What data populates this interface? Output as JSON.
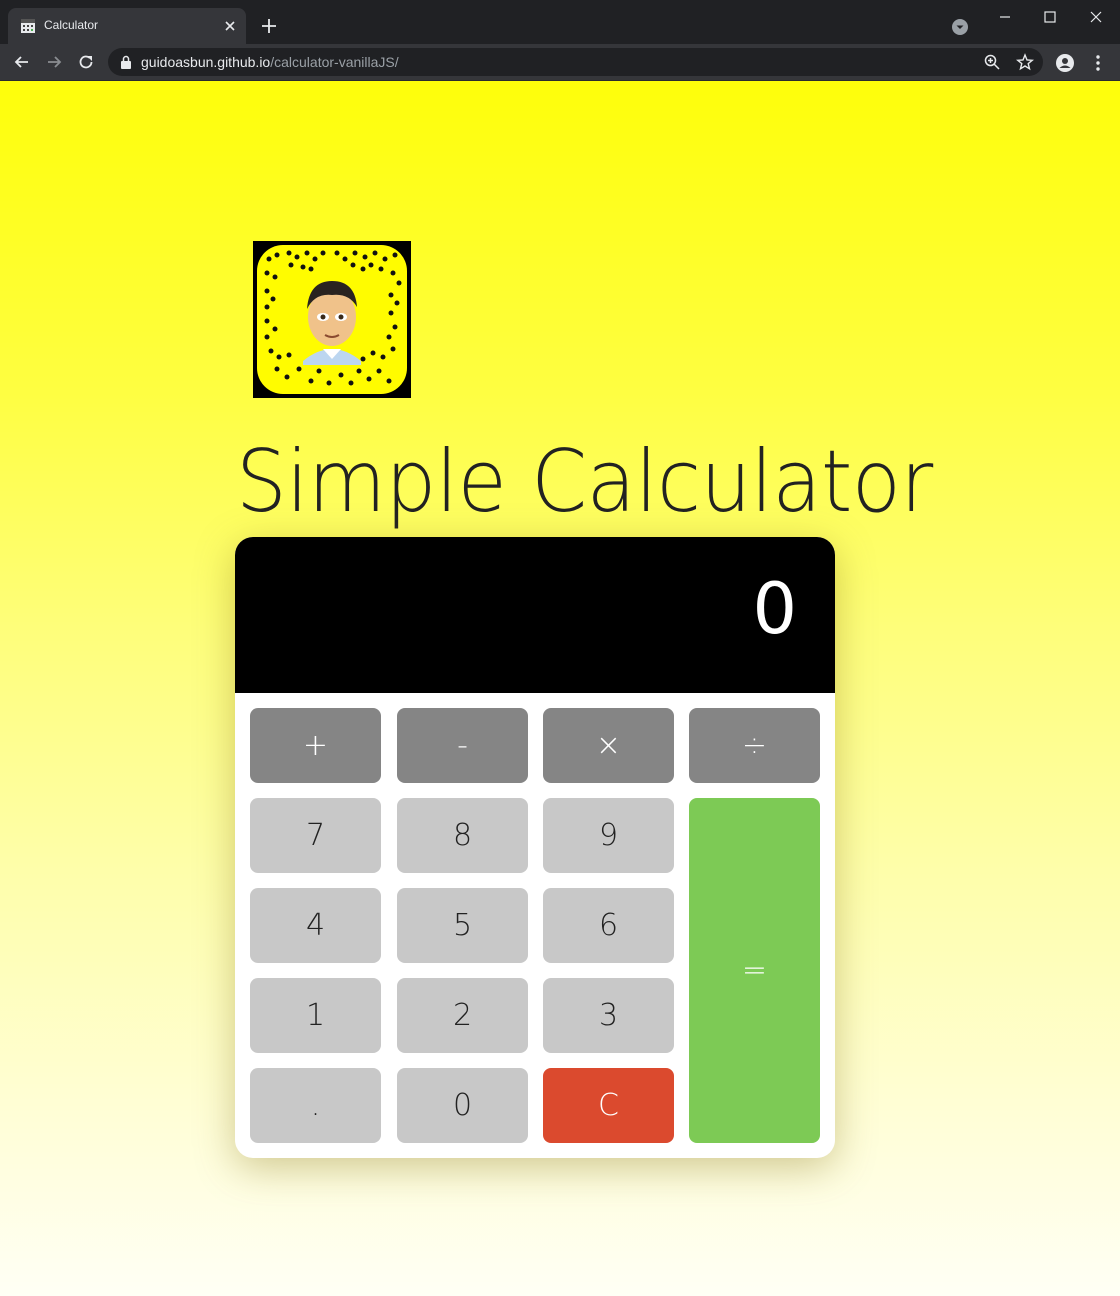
{
  "browser": {
    "tab_title": "Calculator",
    "url_host": "guidoasbun.github.io",
    "url_path": "/calculator-vanillaJS/"
  },
  "page": {
    "title": "Simple Calculator",
    "background_top": "#fefe0a",
    "background_bottom": "#fffff5"
  },
  "calculator": {
    "display": "0",
    "operators": {
      "add": "+",
      "subtract": "-",
      "multiply": "×",
      "divide": "÷"
    },
    "digits": {
      "d7": "7",
      "d8": "8",
      "d9": "9",
      "d4": "4",
      "d5": "5",
      "d6": "6",
      "d1": "1",
      "d2": "2",
      "d3": "3",
      "d0": "0"
    },
    "decimal": ".",
    "clear": "C",
    "equals": "=",
    "colors": {
      "operator": "#858585",
      "digit": "#c8c8c8",
      "clear": "#db4a2e",
      "equals": "#7dca55",
      "display": "#000000"
    }
  }
}
